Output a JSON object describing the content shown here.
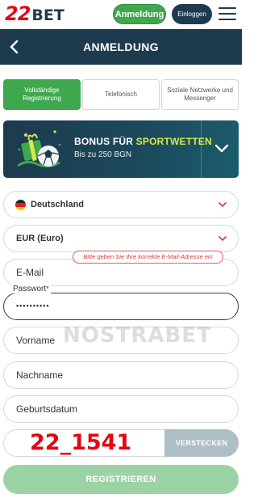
{
  "header": {
    "logo_num": "22",
    "logo_text": "BET",
    "register_label": "Anmeldung",
    "login_label": "Einloggen"
  },
  "titlebar": {
    "title": "ANMELDUNG"
  },
  "tabs": [
    {
      "label": "Vollständige Registrierung",
      "active": true
    },
    {
      "label": "Telefonisch",
      "active": false
    },
    {
      "label": "Soziale Netzwerke und Messenger",
      "active": false
    }
  ],
  "bonus": {
    "title_prefix": "BONUS FÜR ",
    "title_highlight": "SPORTWETTEN",
    "subtitle": "Bis zu 250 BGN"
  },
  "form": {
    "country": "Deutschland",
    "currency": "EUR (Euro)",
    "email_placeholder": "E-Mail",
    "email_error": "Bitte geben Sie Ihre korrekte E-Mail-Adresse ein",
    "password_label": "Passwort",
    "password_required": "*",
    "password_value": "••••••••••",
    "firstname_placeholder": "Vorname",
    "lastname_placeholder": "Nachname",
    "birthdate_placeholder": "Geburtsdatum",
    "promo_code": "22_1541",
    "hide_label": "VERSTECKEN",
    "submit_label": "REGISTRIEREN"
  },
  "watermark": "NOSTRABET",
  "colors": {
    "brand_red": "#e30613",
    "navy": "#1e3a4f",
    "green": "#3fa84f",
    "green_disabled": "#9bd3a5",
    "error_red": "#d63a3a"
  }
}
